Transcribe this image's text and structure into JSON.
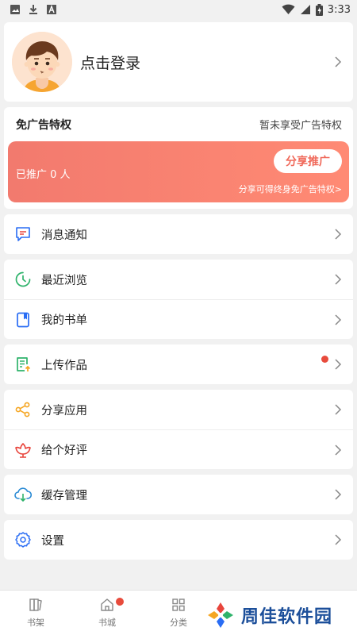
{
  "status_bar": {
    "time": "3:33"
  },
  "profile": {
    "login_text": "点击登录"
  },
  "ad_privilege": {
    "title": "免广告特权",
    "status": "暂未享受广告特权",
    "promoted_count": "已推广 0 人",
    "share_button": "分享推广",
    "hint": "分享可得终身免广告特权>"
  },
  "menu": {
    "notifications": "消息通知",
    "recent": "最近浏览",
    "booklist": "我的书单",
    "upload": "上传作品",
    "share_app": "分享应用",
    "rate": "给个好评",
    "cache": "缓存管理",
    "settings": "设置"
  },
  "tabs": {
    "bookshelf": "书架",
    "bookstore": "书城",
    "category": "分类"
  },
  "watermark": {
    "text": "周佳软件园"
  },
  "colors": {
    "promo_gradient_start": "#f27a6e",
    "promo_gradient_end": "#ff8a74",
    "badge_red": "#e84b3c",
    "icon_blue": "#2a6df4",
    "icon_green": "#2fb36b",
    "icon_orange": "#f5a623",
    "icon_red": "#e8453c"
  }
}
